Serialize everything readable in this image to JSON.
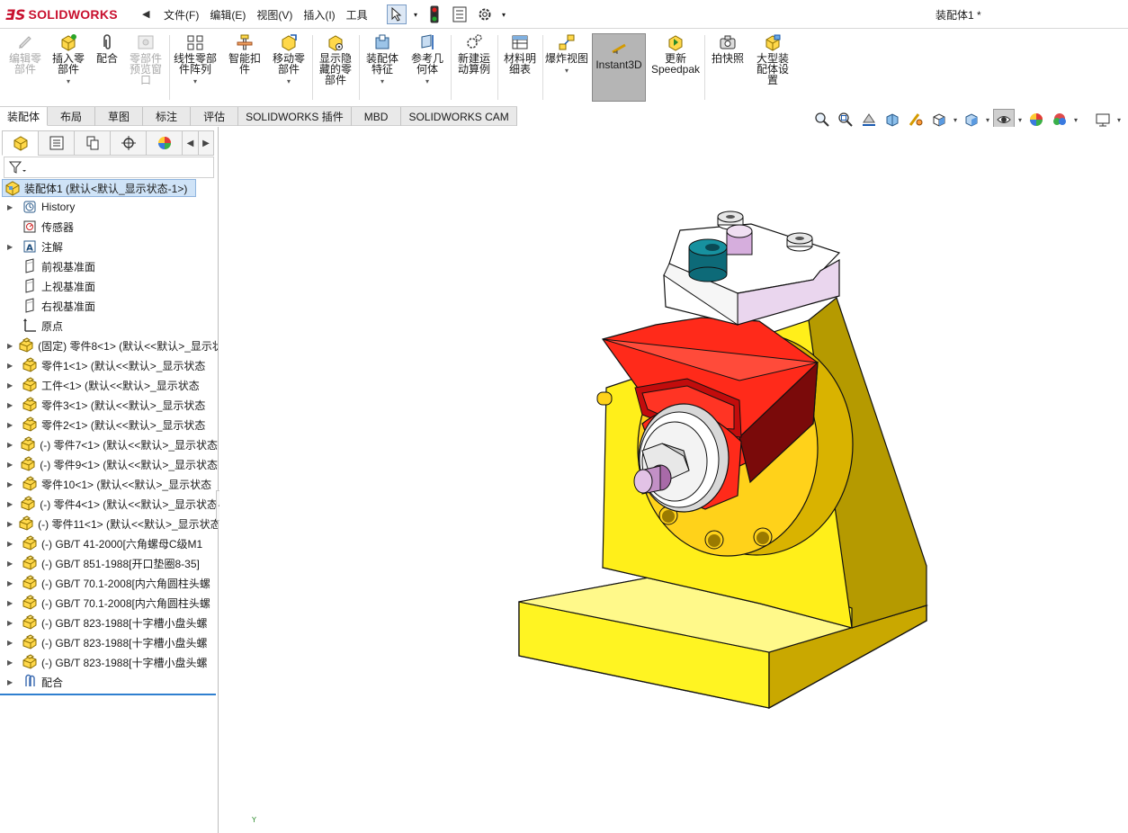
{
  "app": {
    "logo_ds": "ƎS",
    "logo_text": "SOLIDWORKS",
    "document_title": "装配体1 *"
  },
  "menu": {
    "items": [
      "文件(F)",
      "编辑(E)",
      "视图(V)",
      "插入(I)",
      "工具"
    ]
  },
  "ribbon": {
    "buttons": [
      {
        "label": "编辑零部件",
        "enabled": false
      },
      {
        "label": "插入零部件",
        "enabled": true
      },
      {
        "label": "配合",
        "enabled": true
      },
      {
        "label": "零部件预览窗口",
        "enabled": false
      },
      {
        "label": "线性零部件阵列",
        "enabled": true
      },
      {
        "label": "智能扣件",
        "enabled": true
      },
      {
        "label": "移动零部件",
        "enabled": true
      },
      {
        "label": "显示隐藏的零部件",
        "enabled": true
      },
      {
        "label": "装配体特征",
        "enabled": true
      },
      {
        "label": "参考几何体",
        "enabled": true
      },
      {
        "label": "新建运动算例",
        "enabled": true
      },
      {
        "label": "材料明细表",
        "enabled": true
      },
      {
        "label": "爆炸视图",
        "enabled": true
      },
      {
        "label": "Instant3D",
        "enabled": true,
        "active": true
      },
      {
        "label": "更新Speedpak",
        "enabled": true
      },
      {
        "label": "拍快照",
        "enabled": true
      },
      {
        "label": "大型装配体设置",
        "enabled": true
      }
    ]
  },
  "command_tabs": [
    "装配体",
    "布局",
    "草图",
    "标注",
    "评估",
    "SOLIDWORKS 插件",
    "MBD",
    "SOLIDWORKS CAM"
  ],
  "active_command_tab": "装配体",
  "tree": {
    "root": "装配体1  (默认<默认_显示状态-1>)",
    "items": [
      {
        "label": "History",
        "icon": "history-icon",
        "expand": true
      },
      {
        "label": "传感器",
        "icon": "sensor-icon",
        "expand": false
      },
      {
        "label": "注解",
        "icon": "annotation-icon",
        "expand": true
      },
      {
        "label": "前视基准面",
        "icon": "plane-icon",
        "expand": false
      },
      {
        "label": "上视基准面",
        "icon": "plane-icon",
        "expand": false
      },
      {
        "label": "右视基准面",
        "icon": "plane-icon",
        "expand": false
      },
      {
        "label": "原点",
        "icon": "origin-icon",
        "expand": false
      },
      {
        "label": "(固定) 零件8<1> (默认<<默认>_显示状态",
        "icon": "part-icon",
        "expand": true
      },
      {
        "label": "零件1<1> (默认<<默认>_显示状态",
        "icon": "part-icon",
        "expand": true
      },
      {
        "label": "工件<1> (默认<<默认>_显示状态",
        "icon": "part-icon",
        "expand": true
      },
      {
        "label": "零件3<1> (默认<<默认>_显示状态",
        "icon": "part-icon",
        "expand": true
      },
      {
        "label": "零件2<1> (默认<<默认>_显示状态",
        "icon": "part-icon",
        "expand": true
      },
      {
        "label": "(-) 零件7<1> (默认<<默认>_显示状态",
        "icon": "part-icon",
        "expand": true
      },
      {
        "label": "(-) 零件9<1> (默认<<默认>_显示状态",
        "icon": "part-icon",
        "expand": true
      },
      {
        "label": "零件10<1> (默认<<默认>_显示状态",
        "icon": "part-icon",
        "expand": true
      },
      {
        "label": "(-) 零件4<1> (默认<<默认>_显示状态",
        "icon": "part-icon",
        "expand": true
      },
      {
        "label": "(-) 零件11<1> (默认<<默认>_显示状态",
        "icon": "part-icon",
        "expand": true
      },
      {
        "label": "(-) GB/T 41-2000[六角螺母C级M1",
        "icon": "part-icon",
        "expand": true
      },
      {
        "label": "(-) GB/T 851-1988[开口垫圈8-35]",
        "icon": "part-icon",
        "expand": true
      },
      {
        "label": "(-) GB/T 70.1-2008[内六角圆柱头螺",
        "icon": "part-icon",
        "expand": true
      },
      {
        "label": "(-) GB/T 70.1-2008[内六角圆柱头螺",
        "icon": "part-icon",
        "expand": true
      },
      {
        "label": "(-) GB/T 823-1988[十字槽小盘头螺",
        "icon": "part-icon",
        "expand": true
      },
      {
        "label": "(-) GB/T 823-1988[十字槽小盘头螺",
        "icon": "part-icon",
        "expand": true
      },
      {
        "label": "(-) GB/T 823-1988[十字槽小盘头螺",
        "icon": "part-icon",
        "expand": true
      },
      {
        "label": "配合",
        "icon": "mates-icon",
        "expand": true
      }
    ]
  },
  "triad_label": "Y",
  "colors": {
    "base_yellow": "#ffef1a",
    "base_shadow": "#b59a00",
    "fixture_red": "#ff2a1a",
    "fixture_dark": "#7a0a0a",
    "bushing_teal": "#137e8e",
    "clamp_white": "#ffffff",
    "clamp_pink": "#ead6ee",
    "pin_purple": "#c290c6"
  }
}
